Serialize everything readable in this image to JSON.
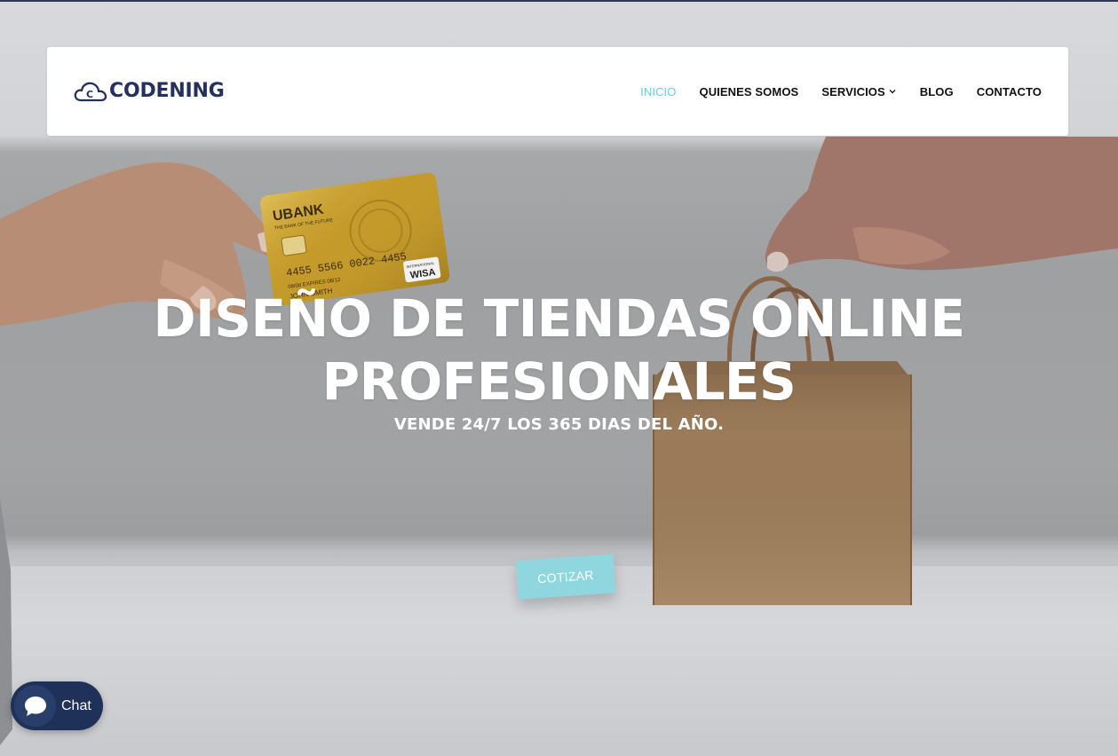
{
  "brand": {
    "name": "CODENING",
    "logo_icon": "cloud-c-logo-icon"
  },
  "nav": {
    "items": [
      {
        "label": "INICIO",
        "active": true
      },
      {
        "label": "QUIENES SOMOS",
        "active": false
      },
      {
        "label": "SERVICIOS",
        "active": false,
        "has_dropdown": true,
        "icon": "chevron-down-icon"
      },
      {
        "label": "BLOG",
        "active": false
      },
      {
        "label": "CONTACTO",
        "active": false
      }
    ]
  },
  "hero": {
    "title_line1": "DISEÑO DE TIENDAS ONLINE",
    "title_line2": "PROFESIONALES",
    "subtitle": "VENDE 24/7 LOS 365 DIAS DEL AÑO.",
    "cta_label": "COTIZAR",
    "card": {
      "bank": "UBANK",
      "tagline": "THE BANK OF THE FUTURE",
      "number": "4455 5566 0022 4455",
      "valid_from": "08/06",
      "expires": "08/12",
      "holder": "JOHN SMITH",
      "network_small": "INTERNATIONAL",
      "network": "WISA"
    }
  },
  "chat": {
    "label": "Chat",
    "icon": "chat-bubble-icon"
  },
  "colors": {
    "accent": "#6fcbd8",
    "cta": "#8fd6df",
    "brand": "#24305d",
    "chat_bg": "#1f3159"
  }
}
